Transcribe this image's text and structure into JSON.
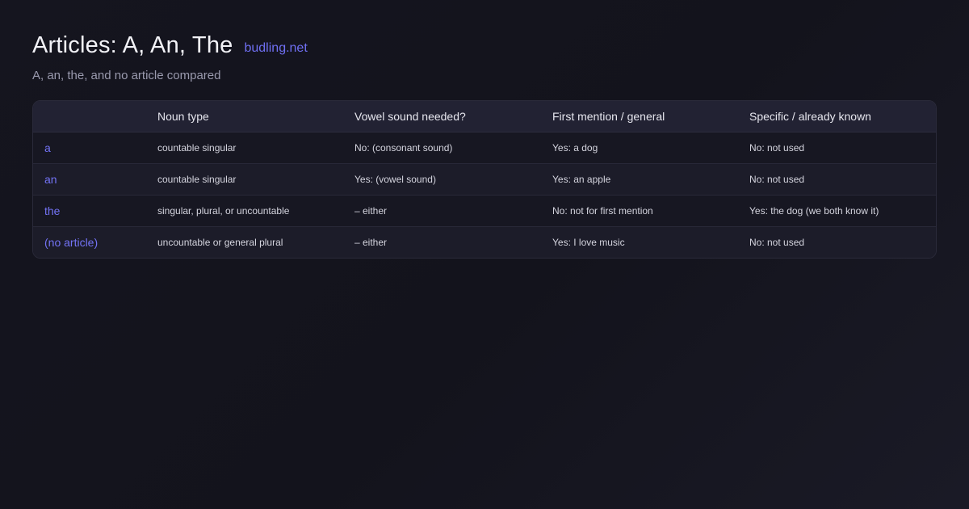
{
  "header": {
    "title": "Articles: A, An, The",
    "brand": "budling.net",
    "subtitle": "A, an, the, and no article compared"
  },
  "table": {
    "columns": [
      "",
      "Noun type",
      "Vowel sound needed?",
      "First mention / general",
      "Specific / already known"
    ],
    "rows": [
      [
        "a",
        "countable singular",
        "No: (consonant sound)",
        "Yes: a dog",
        "No: not used"
      ],
      [
        "an",
        "countable singular",
        "Yes: (vowel sound)",
        "Yes: an apple",
        "No: not used"
      ],
      [
        "the",
        "singular, plural, or uncountable",
        "– either",
        "No: not for first mention",
        "Yes: the dog (we both know it)"
      ],
      [
        "(no article)",
        "uncountable or general plural",
        "– either",
        "Yes: I love music",
        "No: not used"
      ]
    ]
  },
  "colors": {
    "accent": "#7373f5",
    "brand": "#6f6ff2",
    "background": "#14141d"
  }
}
